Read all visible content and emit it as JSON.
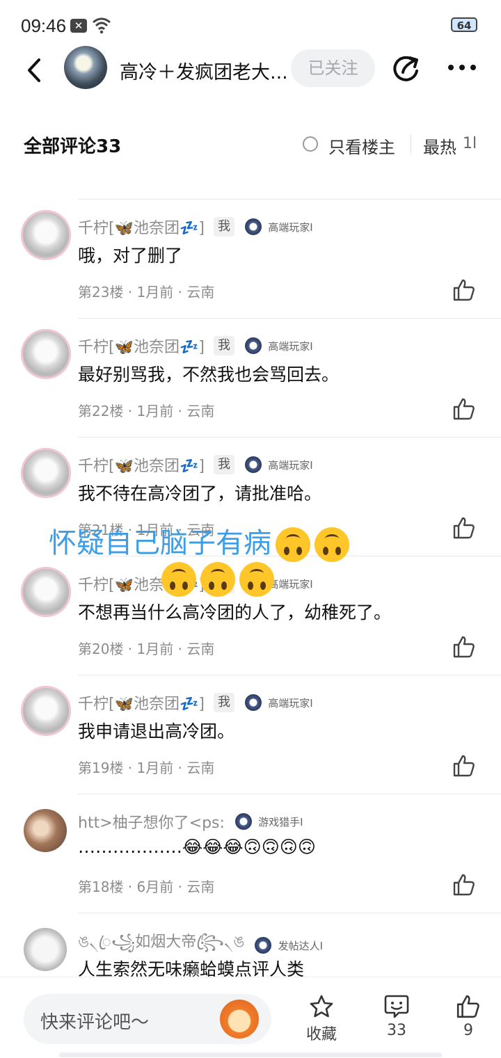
{
  "status_bar": {
    "time": "09:46",
    "battery": "64"
  },
  "header": {
    "title": "高冷＋发疯团老大...",
    "follow_label": "已关注"
  },
  "comments_bar": {
    "title": "全部评论33",
    "only_op": "只看楼主",
    "sort": "最热",
    "sort_icon": "1l"
  },
  "comments": [
    {
      "username": "千柠[🦋池奈团💤]",
      "me_tag": "我",
      "level": "高端玩家I",
      "content": "哦，对了删了",
      "meta": "第23楼 · 1月前 · 云南"
    },
    {
      "username": "千柠[🦋池奈团💤]",
      "me_tag": "我",
      "level": "高端玩家I",
      "content": "最好别骂我，不然我也会骂回去。",
      "meta": "第22楼 · 1月前 · 云南"
    },
    {
      "username": "千柠[🦋池奈团💤]",
      "me_tag": "我",
      "level": "高端玩家I",
      "content": "我不待在高冷团了，请批准哈。",
      "meta": "第21楼 · 1月前 · 云南"
    },
    {
      "username": "千柠[🦋池奈团💤]",
      "me_tag": "我",
      "level": "高端玩家I",
      "content": "不想再当什么高冷团的人了，幼稚死了。",
      "meta": "第20楼 · 1月前 · 云南"
    },
    {
      "username": "千柠[🦋池奈团💤]",
      "me_tag": "我",
      "level": "高端玩家I",
      "content": "我申请退出高冷团。",
      "meta": "第19楼 · 1月前 · 云南"
    },
    {
      "username": "htt>柚子想你了<ps:",
      "level": "游戏猎手I",
      "content": "………………😂😂😂🙃🙃🙃🙃",
      "meta": "第18楼 · 6月前 · 云南"
    },
    {
      "username": "ঙ৲ꦿ꧁如烟大帝꧂ꦿ৲ঙ",
      "level": "发帖达人I",
      "content": "人生索然无味癞蛤蟆点评人类",
      "meta": ""
    }
  ],
  "overlay": {
    "text": "怀疑自己脑子有病"
  },
  "bottom_bar": {
    "placeholder": "快来评论吧～",
    "collect_label": "收藏",
    "comment_count": "33",
    "like_count": "9"
  }
}
